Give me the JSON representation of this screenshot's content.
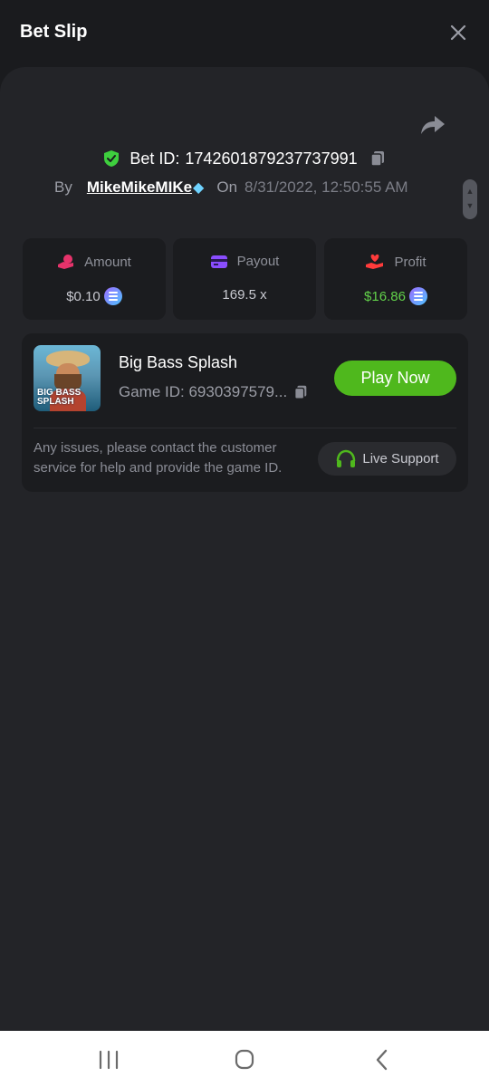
{
  "header": {
    "title": "Bet Slip"
  },
  "bet": {
    "id_label": "Bet ID:",
    "id_value": "1742601879237737991",
    "by_label": "By",
    "username": "MikeMikeMIKe",
    "on_label": "On",
    "date": "8/31/2022, 12:50:55 AM"
  },
  "stats": {
    "amount": {
      "label": "Amount",
      "value": "$0.10"
    },
    "payout": {
      "label": "Payout",
      "value": "169.5 x"
    },
    "profit": {
      "label": "Profit",
      "value": "$16.86"
    }
  },
  "game": {
    "title": "Big Bass Splash",
    "id_text": "Game ID: 6930397579...",
    "thumb_text": "BIG BASS SPLASH",
    "play_label": "Play Now",
    "issue_text": "Any issues, please contact the customer service for help and provide the game ID.",
    "support_label": "Live Support"
  },
  "colors": {
    "accent_green": "#4fb81d",
    "profit_green": "#62d14a",
    "amount_icon": "#e6336b",
    "payout_icon": "#8a4dff",
    "profit_icon": "#ff3b3b",
    "shield": "#3ecf3e"
  },
  "icons": [
    "close-icon",
    "share-icon",
    "shield-check-icon",
    "copy-icon",
    "gem-icon",
    "hand-coin-icon",
    "wallet-icon",
    "hand-heart-icon",
    "headset-icon",
    "recent-apps-icon",
    "home-icon",
    "back-icon"
  ]
}
